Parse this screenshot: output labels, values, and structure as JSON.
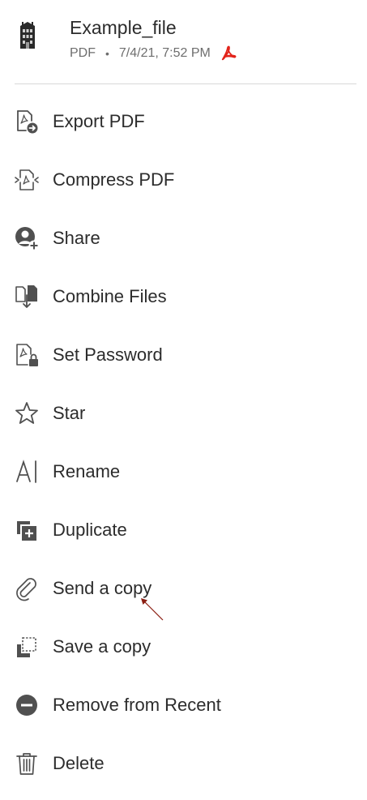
{
  "header": {
    "file_name": "Example_file",
    "file_type": "PDF",
    "separator": "•",
    "date": "7/4/21, 7:52 PM",
    "thumbnail_icon": "building-thumbnail-icon",
    "type_icon": "acrobat-pdf-icon",
    "brand_color": "#e2231a"
  },
  "menu": {
    "items": [
      {
        "label": "Export PDF",
        "icon": "export-pdf-icon"
      },
      {
        "label": "Compress PDF",
        "icon": "compress-pdf-icon"
      },
      {
        "label": "Share",
        "icon": "share-person-add-icon"
      },
      {
        "label": "Combine Files",
        "icon": "combine-files-icon"
      },
      {
        "label": "Set Password",
        "icon": "lock-pdf-icon"
      },
      {
        "label": "Star",
        "icon": "star-icon"
      },
      {
        "label": "Rename",
        "icon": "rename-text-cursor-icon"
      },
      {
        "label": "Duplicate",
        "icon": "duplicate-icon"
      },
      {
        "label": "Send a copy",
        "icon": "paperclip-icon"
      },
      {
        "label": "Save a copy",
        "icon": "save-copy-icon"
      },
      {
        "label": "Remove from Recent",
        "icon": "remove-circle-icon"
      },
      {
        "label": "Delete",
        "icon": "trash-icon"
      }
    ]
  },
  "colors": {
    "text": "#2c2c2c",
    "icon": "#505050",
    "divider": "#d9d9d9",
    "annotation_arrow": "#8b1e12"
  }
}
